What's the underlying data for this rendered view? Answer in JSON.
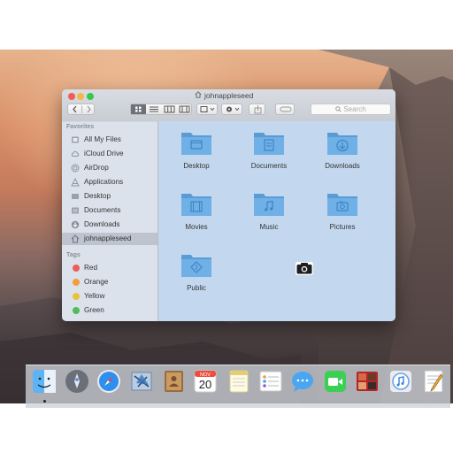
{
  "window": {
    "title": "johnappleseed",
    "search_placeholder": "Search"
  },
  "sidebar": {
    "favorites_header": "Favorites",
    "favorites": [
      {
        "label": "All My Files",
        "icon": "all-files-icon"
      },
      {
        "label": "iCloud Drive",
        "icon": "cloud-icon"
      },
      {
        "label": "AirDrop",
        "icon": "airdrop-icon"
      },
      {
        "label": "Applications",
        "icon": "applications-icon"
      },
      {
        "label": "Desktop",
        "icon": "desktop-icon"
      },
      {
        "label": "Documents",
        "icon": "documents-icon"
      },
      {
        "label": "Downloads",
        "icon": "downloads-icon"
      },
      {
        "label": "johnappleseed",
        "icon": "home-icon",
        "selected": true
      }
    ],
    "tags_header": "Tags",
    "tags": [
      {
        "label": "Red",
        "color": "#ee5c5c"
      },
      {
        "label": "Orange",
        "color": "#f39c3c"
      },
      {
        "label": "Yellow",
        "color": "#e6c43a"
      },
      {
        "label": "Green",
        "color": "#4cbf5a"
      }
    ]
  },
  "folders": [
    {
      "label": "Desktop",
      "glyph": "desktop-glyph"
    },
    {
      "label": "Documents",
      "glyph": "documents-glyph"
    },
    {
      "label": "Downloads",
      "glyph": "downloads-glyph"
    },
    {
      "label": "Movies",
      "glyph": "movies-glyph"
    },
    {
      "label": "Music",
      "glyph": "music-glyph"
    },
    {
      "label": "Pictures",
      "glyph": "pictures-glyph"
    },
    {
      "label": "Public",
      "glyph": "public-glyph"
    }
  ],
  "dock": {
    "calendar_month": "NOV",
    "calendar_day": "20",
    "apps": [
      "finder-icon",
      "launchpad-icon",
      "safari-icon",
      "mail-icon",
      "contacts-icon",
      "calendar-icon",
      "notes-icon",
      "reminders-icon",
      "messages-icon",
      "facetime-icon",
      "photo-booth-icon",
      "itunes-icon",
      "textedit-icon"
    ]
  },
  "colors": {
    "folder": "#6fb0e6",
    "folder_dark": "#5a9bd5",
    "content_bg": "#c3d8ef"
  }
}
